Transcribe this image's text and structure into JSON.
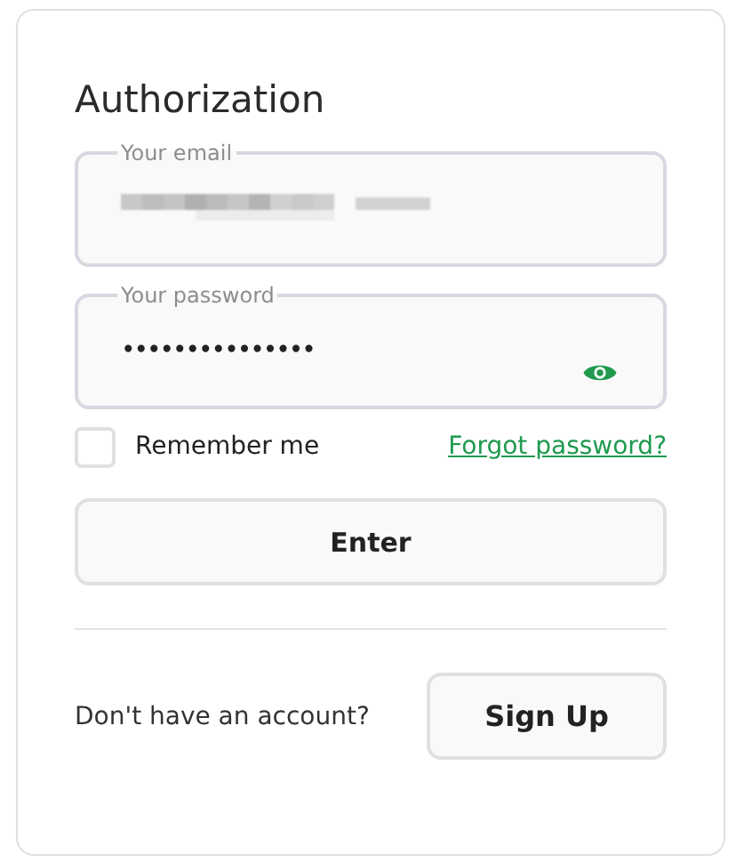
{
  "title": "Authorization",
  "fields": [
    {
      "kind": "email",
      "label": "Your email",
      "redacted": true
    },
    {
      "kind": "password",
      "label": "Your password",
      "value": "•••••••••••••••"
    }
  ],
  "remember": {
    "label": "Remember me",
    "checked": false
  },
  "forgot_link": "Forgot password?",
  "submit_button": "Enter",
  "signup": {
    "prompt": "Don't have an account?",
    "button": "Sign Up"
  }
}
